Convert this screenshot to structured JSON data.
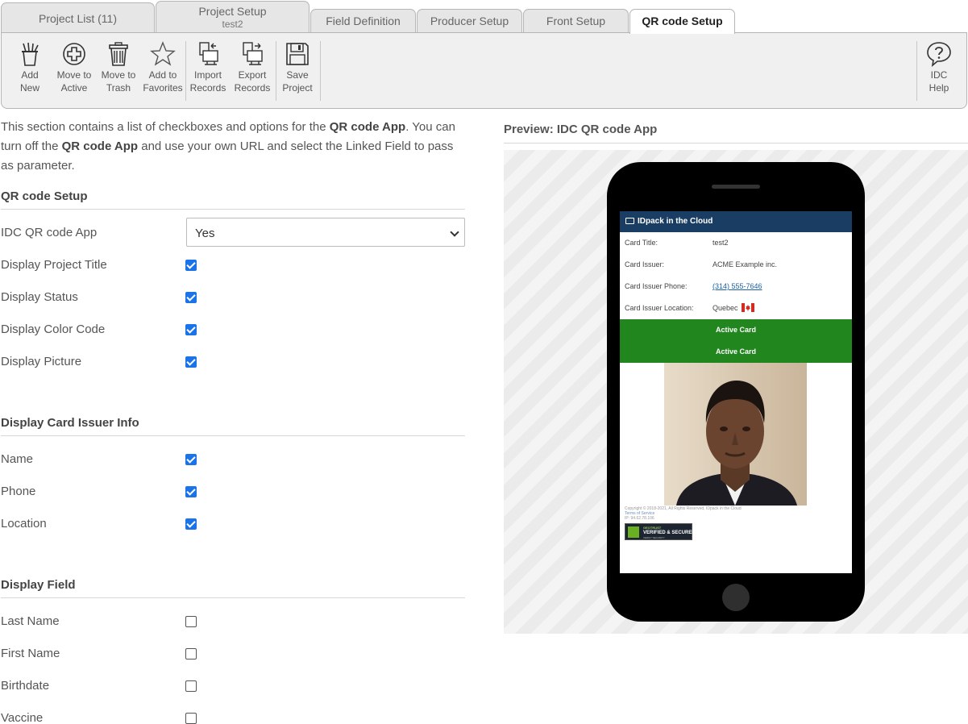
{
  "tabs": [
    {
      "label": "Project List (11)",
      "sub": ""
    },
    {
      "label": "Project Setup",
      "sub": "test2"
    },
    {
      "label": "Field Definition",
      "sub": ""
    },
    {
      "label": "Producer Setup",
      "sub": ""
    },
    {
      "label": "Front Setup",
      "sub": ""
    },
    {
      "label": "QR code Setup",
      "sub": ""
    }
  ],
  "toolbar": {
    "add_new": [
      "Add",
      "New"
    ],
    "move_active": [
      "Move to",
      "Active"
    ],
    "move_trash": [
      "Move to",
      "Trash"
    ],
    "add_favorites": [
      "Add to",
      "Favorites"
    ],
    "import_records": [
      "Import",
      "Records"
    ],
    "export_records": [
      "Export",
      "Records"
    ],
    "save_project": [
      "Save",
      "Project"
    ],
    "idc_help": [
      "IDC",
      "Help"
    ]
  },
  "intro": {
    "p1": "This section contains a list of checkboxes and options for the ",
    "b1": "QR code App",
    "p2": ". You can turn off the ",
    "b2": "QR code App",
    "p3": " and use your own URL and select the Linked Field to pass as parameter."
  },
  "qr_setup": {
    "title": "QR code Setup",
    "app_label": "IDC QR code App",
    "app_value": "Yes",
    "display_project_title": {
      "label": "Display Project Title",
      "checked": true
    },
    "display_status": {
      "label": "Display Status",
      "checked": true
    },
    "display_color_code": {
      "label": "Display Color Code",
      "checked": true
    },
    "display_picture": {
      "label": "Display Picture",
      "checked": true
    }
  },
  "issuer_info": {
    "title": "Display Card Issuer Info",
    "name": {
      "label": "Name",
      "checked": true
    },
    "phone": {
      "label": "Phone",
      "checked": true
    },
    "location": {
      "label": "Location",
      "checked": true
    }
  },
  "display_field": {
    "title": "Display Field",
    "last_name": {
      "label": "Last Name",
      "checked": false
    },
    "first_name": {
      "label": "First Name",
      "checked": false
    },
    "birthdate": {
      "label": "Birthdate",
      "checked": false
    },
    "vaccine": {
      "label": "Vaccine",
      "checked": false
    }
  },
  "preview": {
    "title": "Preview: IDC QR code App",
    "app_title": "IDpack in the Cloud",
    "rows": [
      {
        "key": "Card Title:",
        "value": "test2"
      },
      {
        "key": "Card Issuer:",
        "value": "ACME Example inc."
      },
      {
        "key": "Card Issuer Phone:",
        "value": "(314) 555-7646"
      },
      {
        "key": "Card Issuer Location:",
        "value": "Quebec"
      }
    ],
    "status1": "Active Card",
    "status2": "Active Card",
    "copyright": "Copyright © 2018-2021, All Rights Reserved, IDpack in the Cloud",
    "terms": "Terms of Service",
    "ip": "IP: 94.62.78.106",
    "badge_top": "GEOTRUST",
    "badge_main": "VERIFIED & SECURED",
    "badge_sub": "VERIFY SECURITY"
  },
  "colors": {
    "accent": "#1a73e8",
    "app_header": "#1a3d63",
    "active_green": "#22861f"
  }
}
